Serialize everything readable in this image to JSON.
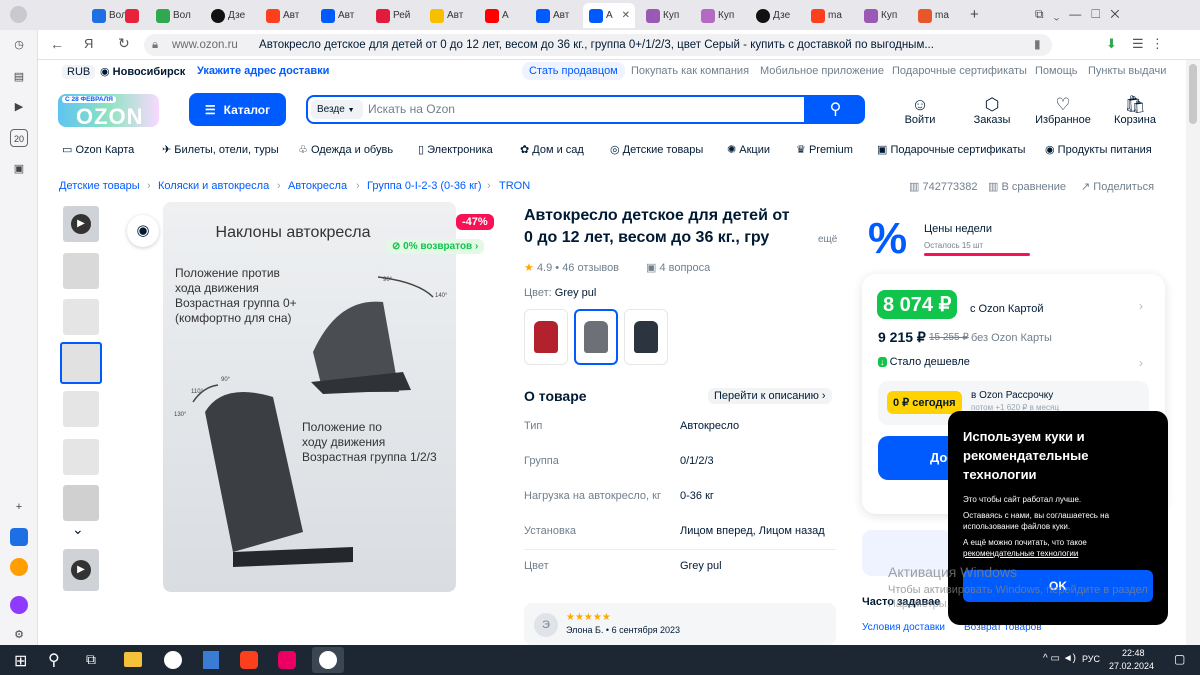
{
  "browser": {
    "tabs": [
      "",
      "",
      "",
      "",
      "Вол",
      "Дзе",
      "Авт",
      "Авт",
      "Рей",
      "Авт",
      "А",
      "Авт",
      "А",
      "Куп",
      "Куп",
      "Дзе",
      "ma",
      "Куп",
      "ma"
    ],
    "active_tab": "А",
    "url_domain": "www.ozon.ru",
    "page_title": "Автокресло детское для детей от 0 до 12 лет, весом до 36 кг., группа 0+/1/2/3, цвет Серый - купить с доставкой по выгодным...",
    "rail_badge": "20"
  },
  "topbar": {
    "currency": "RUB",
    "city": "Новосибирск",
    "address_link": "Укажите адрес доставки",
    "links": [
      "Стать продавцом",
      "Покупать как компания",
      "Мобильное приложение",
      "Подарочные сертификаты",
      "Помощь",
      "Пункты выдачи"
    ]
  },
  "header": {
    "logo_sub": "С 28 ФЕВРАЛЯ",
    "logo": "OZON",
    "catalog": "Каталог",
    "search_scope": "Везде",
    "search_placeholder": "Искать на Ozon",
    "icons": [
      "Войти",
      "Заказы",
      "Избранное",
      "Корзина"
    ]
  },
  "nav": [
    "Ozon Карта",
    "Билеты, отели, туры",
    "Одежда и обувь",
    "Электроника",
    "Дом и сад",
    "Детские товары",
    "Акции",
    "Premium",
    "Подарочные сертификаты",
    "Продукты питания"
  ],
  "breadcrumbs": [
    "Детские товары",
    "Коляски и автокресла",
    "Автокресла",
    "Группа 0-I-2-3 (0-36 кг)",
    "TRON"
  ],
  "product_meta": {
    "sku": "742773382",
    "compare": "В сравнение",
    "share": "Поделиться"
  },
  "image": {
    "discount": "-47%",
    "returns": "0% возвратов",
    "heading": "Наклоны автокресла",
    "text1": [
      "Положение против",
      "хода движения",
      "Возрастная группа 0+",
      "(комфортно для сна)"
    ],
    "text2": [
      "Положение по",
      "ходу движения",
      "Возрастная группа 1/2/3"
    ],
    "angles": [
      "90°",
      "140°",
      "110°",
      "90°",
      "130°"
    ]
  },
  "product": {
    "title_lines": [
      "Автокресло детское для детей от",
      "0 до 12 лет, весом до 36 кг., гру"
    ],
    "more": "ещё",
    "rating": "4.9 • 46 отзывов",
    "questions": "4 вопроса",
    "color_label": "Цвет:",
    "color_value": "Grey pul",
    "about": "О товаре",
    "to_description": "Перейти к описанию",
    "specs": [
      {
        "label": "Тип",
        "value": "Автокресло"
      },
      {
        "label": "Группа",
        "value": "0/1/2/3"
      },
      {
        "label": "Нагрузка на автокресло, кг",
        "value": "0-36 кг"
      },
      {
        "label": "Установка",
        "value": "Лицом вперед, Лицом назад"
      },
      {
        "label": "Цвет",
        "value": "Grey pul"
      }
    ],
    "review_initial": "Э",
    "review_author": "Элона Б. • 6 сентября 2023"
  },
  "price": {
    "promo_title": "Цены недели",
    "promo_sub": "Осталось 15 шт",
    "card_price": "8 074 ₽",
    "card_label": "с Ozon Картой",
    "price": "9 215 ₽",
    "old_price": "15 255 ₽",
    "price_label": "без Ozon Карты",
    "cheaper": "Стало дешевле",
    "installment_today": "0 ₽ сегодня",
    "installment_label": "в Ozon Рассрочку",
    "installment_sub": "потом +1 620 ₽ в месяц",
    "cart_button": "Дос"
  },
  "footer_links": {
    "faq": "Часто задавае",
    "delivery": "Условия доставки",
    "returns": "Возврат товаров"
  },
  "cookie": {
    "title": "Используем куки и рекомендательные технологии",
    "text1": "Это чтобы сайт работал лучше.",
    "text2": "Оставаясь с нами, вы соглашаетесь на использование файлов куки.",
    "text3": "А ещё можно почитать, что такое",
    "link": "рекомендательные технологии",
    "ok": "OK"
  },
  "watermark": {
    "line1": "Активация Windows",
    "line2": "Чтобы активировать Windows, перейдите в раздел",
    "line3": "Параметры."
  },
  "taskbar": {
    "lang": "РУС",
    "time": "22:48",
    "date": "27.02.2024"
  }
}
